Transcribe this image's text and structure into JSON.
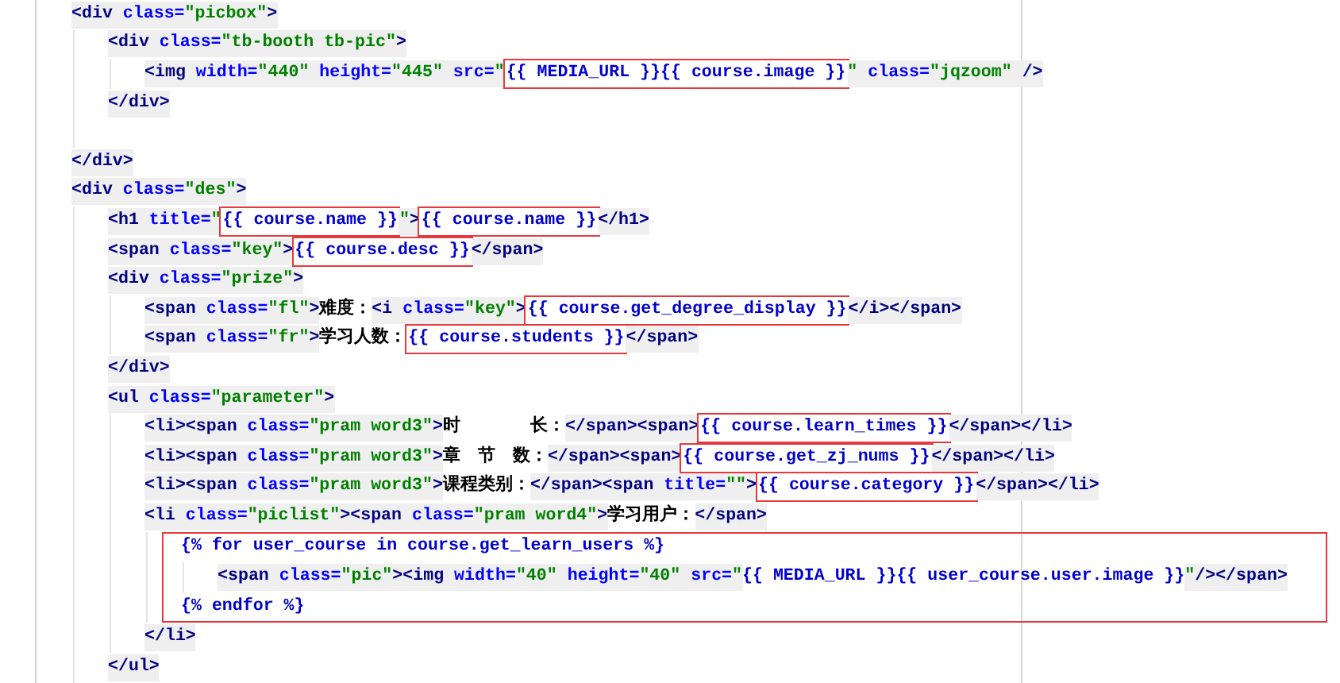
{
  "editor": {
    "lines": [
      {
        "kind": "code",
        "tokens": [
          {
            "kind": "tag",
            "text": "<div",
            "highlighted": false
          },
          {
            "kind": "attr",
            "text": " class=",
            "highlighted": false
          },
          {
            "kind": "value",
            "text": "\"picbox\"",
            "highlighted": false
          },
          {
            "kind": "tag",
            "text": ">",
            "highlighted": false
          }
        ],
        "children": [
          {
            "kind": "code",
            "tokens": [
              {
                "kind": "tag",
                "text": "<div",
                "highlighted": false
              },
              {
                "kind": "attr",
                "text": " class=",
                "highlighted": false
              },
              {
                "kind": "value",
                "text": "\"tb-booth tb-pic\"",
                "highlighted": false
              },
              {
                "kind": "tag",
                "text": ">",
                "highlighted": false
              }
            ],
            "children": [
              {
                "kind": "code",
                "tokens": [
                  {
                    "kind": "tag",
                    "text": "<img",
                    "highlighted": false
                  },
                  {
                    "kind": "attr",
                    "text": " width=",
                    "highlighted": false
                  },
                  {
                    "kind": "value",
                    "text": "\"440\"",
                    "highlighted": false
                  },
                  {
                    "kind": "attr",
                    "text": " height=",
                    "highlighted": false
                  },
                  {
                    "kind": "value",
                    "text": "\"445\"",
                    "highlighted": false
                  },
                  {
                    "kind": "attr",
                    "text": " src=",
                    "highlighted": false
                  },
                  {
                    "kind": "value",
                    "text": "\"",
                    "highlighted": false
                  },
                  {
                    "kind": "tpl",
                    "text": "{{ MEDIA_URL }}{{ course.image }}",
                    "highlighted": true
                  },
                  {
                    "kind": "value",
                    "text": "\"",
                    "highlighted": false
                  },
                  {
                    "kind": "attr",
                    "text": " class=",
                    "highlighted": false
                  },
                  {
                    "kind": "value",
                    "text": "\"jqzoom\"",
                    "highlighted": false
                  },
                  {
                    "kind": "tag",
                    "text": " />",
                    "highlighted": false
                  }
                ]
              }
            ]
          },
          {
            "kind": "code",
            "tokens": [
              {
                "kind": "tag",
                "text": "</div>",
                "highlighted": false
              }
            ]
          },
          {
            "kind": "blank"
          }
        ]
      },
      {
        "kind": "code",
        "tokens": [
          {
            "kind": "tag",
            "text": "</div>",
            "highlighted": false
          }
        ]
      },
      {
        "kind": "code",
        "tokens": [
          {
            "kind": "tag",
            "text": "<div",
            "highlighted": false
          },
          {
            "kind": "attr",
            "text": " class=",
            "highlighted": false
          },
          {
            "kind": "value",
            "text": "\"des\"",
            "highlighted": false
          },
          {
            "kind": "tag",
            "text": ">",
            "highlighted": false
          }
        ],
        "children": [
          {
            "kind": "code",
            "tokens": [
              {
                "kind": "tag",
                "text": "<h1",
                "highlighted": false
              },
              {
                "kind": "attr",
                "text": " title=",
                "highlighted": false
              },
              {
                "kind": "value",
                "text": "\"",
                "highlighted": false
              },
              {
                "kind": "tpl",
                "text": "{{ course.name }}",
                "highlighted": true
              },
              {
                "kind": "value",
                "text": "\"",
                "highlighted": false
              },
              {
                "kind": "tag",
                "text": ">",
                "highlighted": false
              },
              {
                "kind": "tpl",
                "text": "{{ course.name }}",
                "highlighted": true
              },
              {
                "kind": "tag",
                "text": "</h1>",
                "highlighted": false
              }
            ]
          },
          {
            "kind": "code",
            "tokens": [
              {
                "kind": "tag",
                "text": "<span",
                "highlighted": false
              },
              {
                "kind": "attr",
                "text": " class=",
                "highlighted": false
              },
              {
                "kind": "value",
                "text": "\"key\"",
                "highlighted": false
              },
              {
                "kind": "tag",
                "text": ">",
                "highlighted": false
              },
              {
                "kind": "tpl",
                "text": "{{ course.desc }}",
                "highlighted": true
              },
              {
                "kind": "tag",
                "text": "</span>",
                "highlighted": false
              }
            ]
          },
          {
            "kind": "code",
            "tokens": [
              {
                "kind": "tag",
                "text": "<div",
                "highlighted": false
              },
              {
                "kind": "attr",
                "text": " class=",
                "highlighted": false
              },
              {
                "kind": "value",
                "text": "\"prize\"",
                "highlighted": false
              },
              {
                "kind": "tag",
                "text": ">",
                "highlighted": false
              }
            ],
            "children": [
              {
                "kind": "code",
                "tokens": [
                  {
                    "kind": "tag",
                    "text": "<span",
                    "highlighted": false
                  },
                  {
                    "kind": "attr",
                    "text": " class=",
                    "highlighted": false
                  },
                  {
                    "kind": "value",
                    "text": "\"fl\"",
                    "highlighted": false
                  },
                  {
                    "kind": "tag",
                    "text": ">",
                    "highlighted": false
                  },
                  {
                    "kind": "text",
                    "text": "难度：",
                    "highlighted": false
                  },
                  {
                    "kind": "tag",
                    "text": "<i",
                    "highlighted": false
                  },
                  {
                    "kind": "attr",
                    "text": " class=",
                    "highlighted": false
                  },
                  {
                    "kind": "value",
                    "text": "\"key\"",
                    "highlighted": false
                  },
                  {
                    "kind": "tag",
                    "text": ">",
                    "highlighted": false
                  },
                  {
                    "kind": "tpl",
                    "text": "{{ course.get_degree_display }}",
                    "highlighted": true
                  },
                  {
                    "kind": "tag",
                    "text": "</i></span>",
                    "highlighted": false
                  }
                ]
              },
              {
                "kind": "code",
                "tokens": [
                  {
                    "kind": "tag",
                    "text": "<span",
                    "highlighted": false
                  },
                  {
                    "kind": "attr",
                    "text": " class=",
                    "highlighted": false
                  },
                  {
                    "kind": "value",
                    "text": "\"fr\"",
                    "highlighted": false
                  },
                  {
                    "kind": "tag",
                    "text": ">",
                    "highlighted": false
                  },
                  {
                    "kind": "text",
                    "text": "学习人数：",
                    "highlighted": false
                  },
                  {
                    "kind": "tpl",
                    "text": "{{ course.students }}",
                    "highlighted": true
                  },
                  {
                    "kind": "tag",
                    "text": "</span>",
                    "highlighted": false
                  }
                ]
              }
            ]
          },
          {
            "kind": "code",
            "tokens": [
              {
                "kind": "tag",
                "text": "</div>",
                "highlighted": false
              }
            ]
          },
          {
            "kind": "code",
            "tokens": [
              {
                "kind": "tag",
                "text": "<ul",
                "highlighted": false
              },
              {
                "kind": "attr",
                "text": " class=",
                "highlighted": false
              },
              {
                "kind": "value",
                "text": "\"parameter\"",
                "highlighted": false
              },
              {
                "kind": "tag",
                "text": ">",
                "highlighted": false
              }
            ],
            "children": [
              {
                "kind": "code",
                "tokens": [
                  {
                    "kind": "tag",
                    "text": "<li><span",
                    "highlighted": false
                  },
                  {
                    "kind": "attr",
                    "text": " class=",
                    "highlighted": false
                  },
                  {
                    "kind": "value",
                    "text": "\"pram word3\"",
                    "highlighted": false
                  },
                  {
                    "kind": "tag",
                    "text": ">",
                    "highlighted": false
                  },
                  {
                    "kind": "text",
                    "text": "时　　　　长：",
                    "highlighted": false
                  },
                  {
                    "kind": "tag",
                    "text": "</span><span>",
                    "highlighted": false
                  },
                  {
                    "kind": "tpl",
                    "text": "{{ course.learn_times }}",
                    "highlighted": true
                  },
                  {
                    "kind": "tag",
                    "text": "</span></li>",
                    "highlighted": false
                  }
                ]
              },
              {
                "kind": "code",
                "tokens": [
                  {
                    "kind": "tag",
                    "text": "<li><span",
                    "highlighted": false
                  },
                  {
                    "kind": "attr",
                    "text": " class=",
                    "highlighted": false
                  },
                  {
                    "kind": "value",
                    "text": "\"pram word3\"",
                    "highlighted": false
                  },
                  {
                    "kind": "tag",
                    "text": ">",
                    "highlighted": false
                  },
                  {
                    "kind": "text",
                    "text": "章　节　数：",
                    "highlighted": false
                  },
                  {
                    "kind": "tag",
                    "text": "</span><span>",
                    "highlighted": false
                  },
                  {
                    "kind": "tpl",
                    "text": "{{ course.get_zj_nums }}",
                    "highlighted": true
                  },
                  {
                    "kind": "tag",
                    "text": "</span></li>",
                    "highlighted": false
                  }
                ]
              },
              {
                "kind": "code",
                "tokens": [
                  {
                    "kind": "tag",
                    "text": "<li><span",
                    "highlighted": false
                  },
                  {
                    "kind": "attr",
                    "text": " class=",
                    "highlighted": false
                  },
                  {
                    "kind": "value",
                    "text": "\"pram word3\"",
                    "highlighted": false
                  },
                  {
                    "kind": "tag",
                    "text": ">",
                    "highlighted": false
                  },
                  {
                    "kind": "text",
                    "text": "课程类别：",
                    "highlighted": false
                  },
                  {
                    "kind": "tag",
                    "text": "</span><span",
                    "highlighted": false
                  },
                  {
                    "kind": "attr",
                    "text": " title=",
                    "highlighted": false
                  },
                  {
                    "kind": "value",
                    "text": "\"\"",
                    "highlighted": false
                  },
                  {
                    "kind": "tag",
                    "text": ">",
                    "highlighted": false
                  },
                  {
                    "kind": "tpl",
                    "text": "{{ course.category }}",
                    "highlighted": true
                  },
                  {
                    "kind": "tag",
                    "text": "</span></li>",
                    "highlighted": false
                  }
                ]
              },
              {
                "kind": "code",
                "tokens": [
                  {
                    "kind": "tag",
                    "text": "<li",
                    "highlighted": false
                  },
                  {
                    "kind": "attr",
                    "text": " class=",
                    "highlighted": false
                  },
                  {
                    "kind": "value",
                    "text": "\"piclist\"",
                    "highlighted": false
                  },
                  {
                    "kind": "tag",
                    "text": "><span",
                    "highlighted": false
                  },
                  {
                    "kind": "attr",
                    "text": " class=",
                    "highlighted": false
                  },
                  {
                    "kind": "value",
                    "text": "\"pram word4\"",
                    "highlighted": false
                  },
                  {
                    "kind": "tag",
                    "text": ">",
                    "highlighted": false
                  },
                  {
                    "kind": "text",
                    "text": "学习用户：",
                    "highlighted": false
                  },
                  {
                    "kind": "tag",
                    "text": "</span>",
                    "highlighted": false
                  }
                ],
                "children": [
                  {
                    "kind": "group",
                    "highlighted": true,
                    "children": [
                      {
                        "kind": "code",
                        "tokens": [
                          {
                            "kind": "tpl",
                            "text": "{% for user_course in course.get_learn_users %}",
                            "highlighted": false
                          }
                        ],
                        "children": [
                          {
                            "kind": "code",
                            "tokens": [
                              {
                                "kind": "tag",
                                "text": "<span",
                                "highlighted": false
                              },
                              {
                                "kind": "attr",
                                "text": " class=",
                                "highlighted": false
                              },
                              {
                                "kind": "value",
                                "text": "\"pic\"",
                                "highlighted": false
                              },
                              {
                                "kind": "tag",
                                "text": "><img",
                                "highlighted": false
                              },
                              {
                                "kind": "attr",
                                "text": " width=",
                                "highlighted": false
                              },
                              {
                                "kind": "value",
                                "text": "\"40\"",
                                "highlighted": false
                              },
                              {
                                "kind": "attr",
                                "text": " height=",
                                "highlighted": false
                              },
                              {
                                "kind": "value",
                                "text": "\"40\"",
                                "highlighted": false
                              },
                              {
                                "kind": "attr",
                                "text": " src=",
                                "highlighted": false
                              },
                              {
                                "kind": "value",
                                "text": "\"",
                                "highlighted": false
                              },
                              {
                                "kind": "tpl",
                                "text": "{{ MEDIA_URL }}{{ user_course.user.image }}",
                                "highlighted": false
                              },
                              {
                                "kind": "value",
                                "text": "\"",
                                "highlighted": false
                              },
                              {
                                "kind": "tag",
                                "text": "/></span>",
                                "highlighted": false
                              }
                            ]
                          }
                        ]
                      },
                      {
                        "kind": "code",
                        "tokens": [
                          {
                            "kind": "tpl",
                            "text": "{% endfor %}",
                            "highlighted": false
                          }
                        ]
                      }
                    ]
                  }
                ]
              },
              {
                "kind": "code",
                "tokens": [
                  {
                    "kind": "tag",
                    "text": "</li>",
                    "highlighted": false
                  }
                ]
              }
            ]
          },
          {
            "kind": "code",
            "tokens": [
              {
                "kind": "tag",
                "text": "</ul>",
                "highlighted": false
              }
            ]
          }
        ]
      }
    ]
  }
}
